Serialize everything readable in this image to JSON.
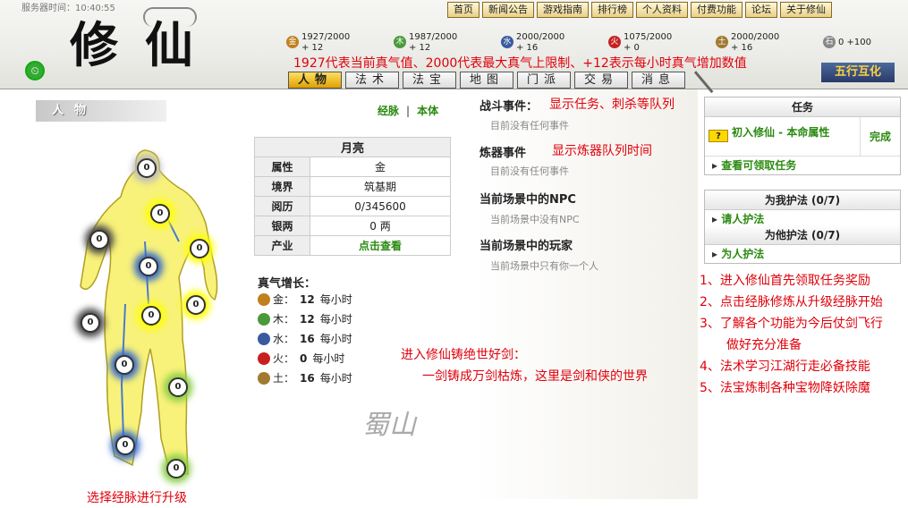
{
  "header": {
    "server_time": "服务器时间：10:40:55",
    "logo_text": "修仙",
    "nav": [
      "首页",
      "新闻公告",
      "游戏指南",
      "排行榜",
      "个人资料",
      "付费功能",
      "论坛",
      "关于修仙"
    ],
    "resources": [
      {
        "icon": "metal-icon",
        "line1": "1927/2000",
        "line2": "+ 12",
        "color": "#c08020"
      },
      {
        "icon": "wood-icon",
        "line1": "1987/2000",
        "line2": "+ 12",
        "color": "#4a9a3a"
      },
      {
        "icon": "water-icon",
        "line1": "2000/2000",
        "line2": "+ 16",
        "color": "#3a5aa0"
      },
      {
        "icon": "fire-icon",
        "line1": "1075/2000",
        "line2": "+ 0",
        "color": "#c82020"
      },
      {
        "icon": "earth-icon",
        "line1": "2000/2000",
        "line2": "+ 16",
        "color": "#a07a30"
      },
      {
        "icon": "stone-icon",
        "line1": "0 +100",
        "line2": "",
        "color": "#888888"
      }
    ],
    "annotation": "1927代表当前真气值、2000代表最大真气上限制、+12表示每小时真气增加数值",
    "tabs": [
      "人物",
      "法术",
      "法宝",
      "地图",
      "门派",
      "交易",
      "消息"
    ],
    "wuxing": "五行互化"
  },
  "left": {
    "section_title": "人物",
    "link_meridian": "经脉",
    "link_base": "本体",
    "caption": "选择经脉进行升级",
    "nodes": [
      "0",
      "0",
      "0",
      "0",
      "0",
      "0",
      "0",
      "0",
      "0",
      "0",
      "0",
      "0"
    ]
  },
  "info": {
    "name": "月亮",
    "rows": [
      {
        "k": "属性",
        "v": "金"
      },
      {
        "k": "境界",
        "v": "筑基期"
      },
      {
        "k": "阅历",
        "v": "0/345600"
      },
      {
        "k": "银两",
        "v": "0 两"
      },
      {
        "k": "产业",
        "v": "点击查看"
      }
    ],
    "growth_title": "真气增长：",
    "growth": [
      {
        "icon": "metal-icon",
        "el": "金：",
        "val": "12",
        "unit": "每小时",
        "color": "#c08020"
      },
      {
        "icon": "wood-icon",
        "el": "木：",
        "val": "12",
        "unit": "每小时",
        "color": "#4a9a3a"
      },
      {
        "icon": "water-icon",
        "el": "水：",
        "val": "16",
        "unit": "每小时",
        "color": "#3a5aa0"
      },
      {
        "icon": "fire-icon",
        "el": "火：",
        "val": "0",
        "unit": "每小时",
        "color": "#c82020"
      },
      {
        "icon": "earth-icon",
        "el": "土：",
        "val": "16",
        "unit": "每小时",
        "color": "#a07a30"
      }
    ]
  },
  "middle": {
    "battle_title": "战斗事件：",
    "battle_anno": "显示任务、刺杀等队列",
    "battle_text": "目前没有任何事件",
    "forge_title": "炼器事件",
    "forge_anno": "显示炼器队列时间",
    "forge_text": "目前没有任何事件",
    "npc_title": "当前场景中的NPC",
    "npc_text": "当前场景中没有NPC",
    "player_title": "当前场景中的玩家",
    "player_text": "当前场景中只有你一个人",
    "promo1": "进入修仙铸绝世好剑：",
    "promo2": "一剑铸成万剑枯炼，这里是剑和侠的世界",
    "watermark": "蜀山"
  },
  "right": {
    "task_header": "任务",
    "task_name": "初入修仙 - 本命属性",
    "task_status": "完成",
    "task_link": "查看可领取任务",
    "protect_me_header": "为我护法 (0/7)",
    "protect_me_link": "请人护法",
    "protect_other_header": "为他护法 (0/7)",
    "protect_other_link": "为人护法",
    "tips": [
      "1、进入修仙首先领取任务奖励",
      "2、点击经脉修炼从升级经脉开始",
      "3、了解各个功能为今后仗剑飞行",
      "做好充分准备",
      "4、法术学习江湖行走必备技能",
      "5、法宝炼制各种宝物降妖除魔"
    ]
  }
}
